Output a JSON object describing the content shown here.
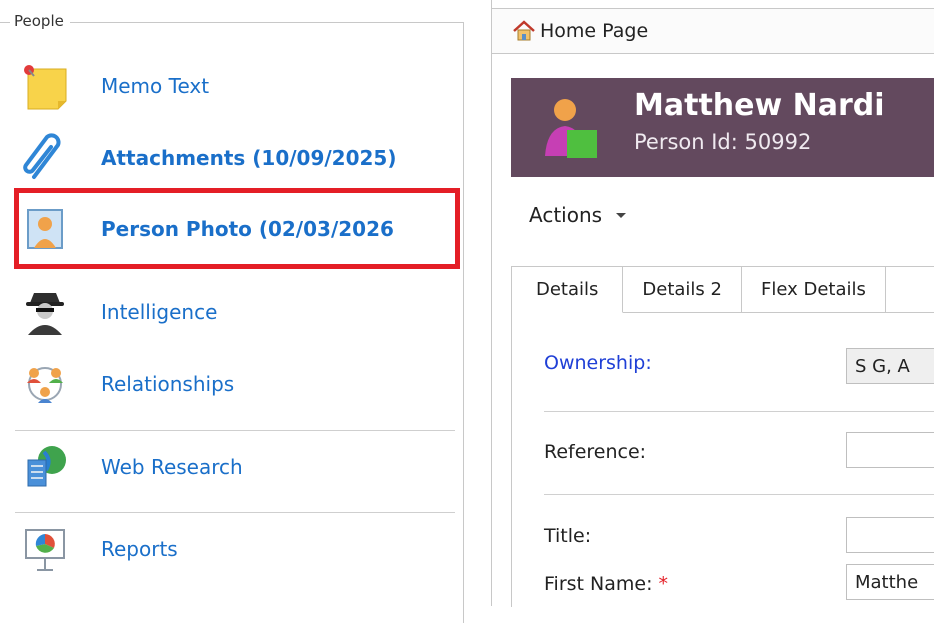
{
  "people_section": {
    "legend": "People",
    "items": [
      {
        "label": "Memo Text",
        "icon": "sticky-note-icon",
        "bold": false
      },
      {
        "label": "Attachments (10/09/2025)",
        "icon": "paperclip-icon",
        "bold": true
      },
      {
        "label": "Person Photo (02/03/2026",
        "icon": "person-photo-icon",
        "bold": true
      },
      {
        "label": "Intelligence",
        "icon": "spy-icon",
        "bold": false
      },
      {
        "label": "Relationships",
        "icon": "people-network-icon",
        "bold": false
      },
      {
        "label": "Web Research",
        "icon": "globe-document-icon",
        "bold": false
      },
      {
        "label": "Reports",
        "icon": "presentation-chart-icon",
        "bold": false
      }
    ],
    "highlight_color": "#e41e26",
    "link_color": "#1a6fc9"
  },
  "breadcrumb": {
    "home_label": "Home Page",
    "icon": "home-icon"
  },
  "person": {
    "name": "Matthew Nardi",
    "id_text": "Person Id: 50992",
    "header_color": "#63495e"
  },
  "actions": {
    "label": "Actions"
  },
  "tabs": [
    {
      "label": "Details",
      "active": true
    },
    {
      "label": "Details 2",
      "active": false
    },
    {
      "label": "Flex Details",
      "active": false
    }
  ],
  "form": {
    "ownership_label": "Ownership:",
    "ownership_value": "S G, A",
    "reference_label": "Reference:",
    "reference_value": "",
    "title_label": "Title:",
    "title_value": "",
    "first_name_label": "First Name:",
    "required_marker": "*",
    "first_name_value": "Matthe"
  }
}
